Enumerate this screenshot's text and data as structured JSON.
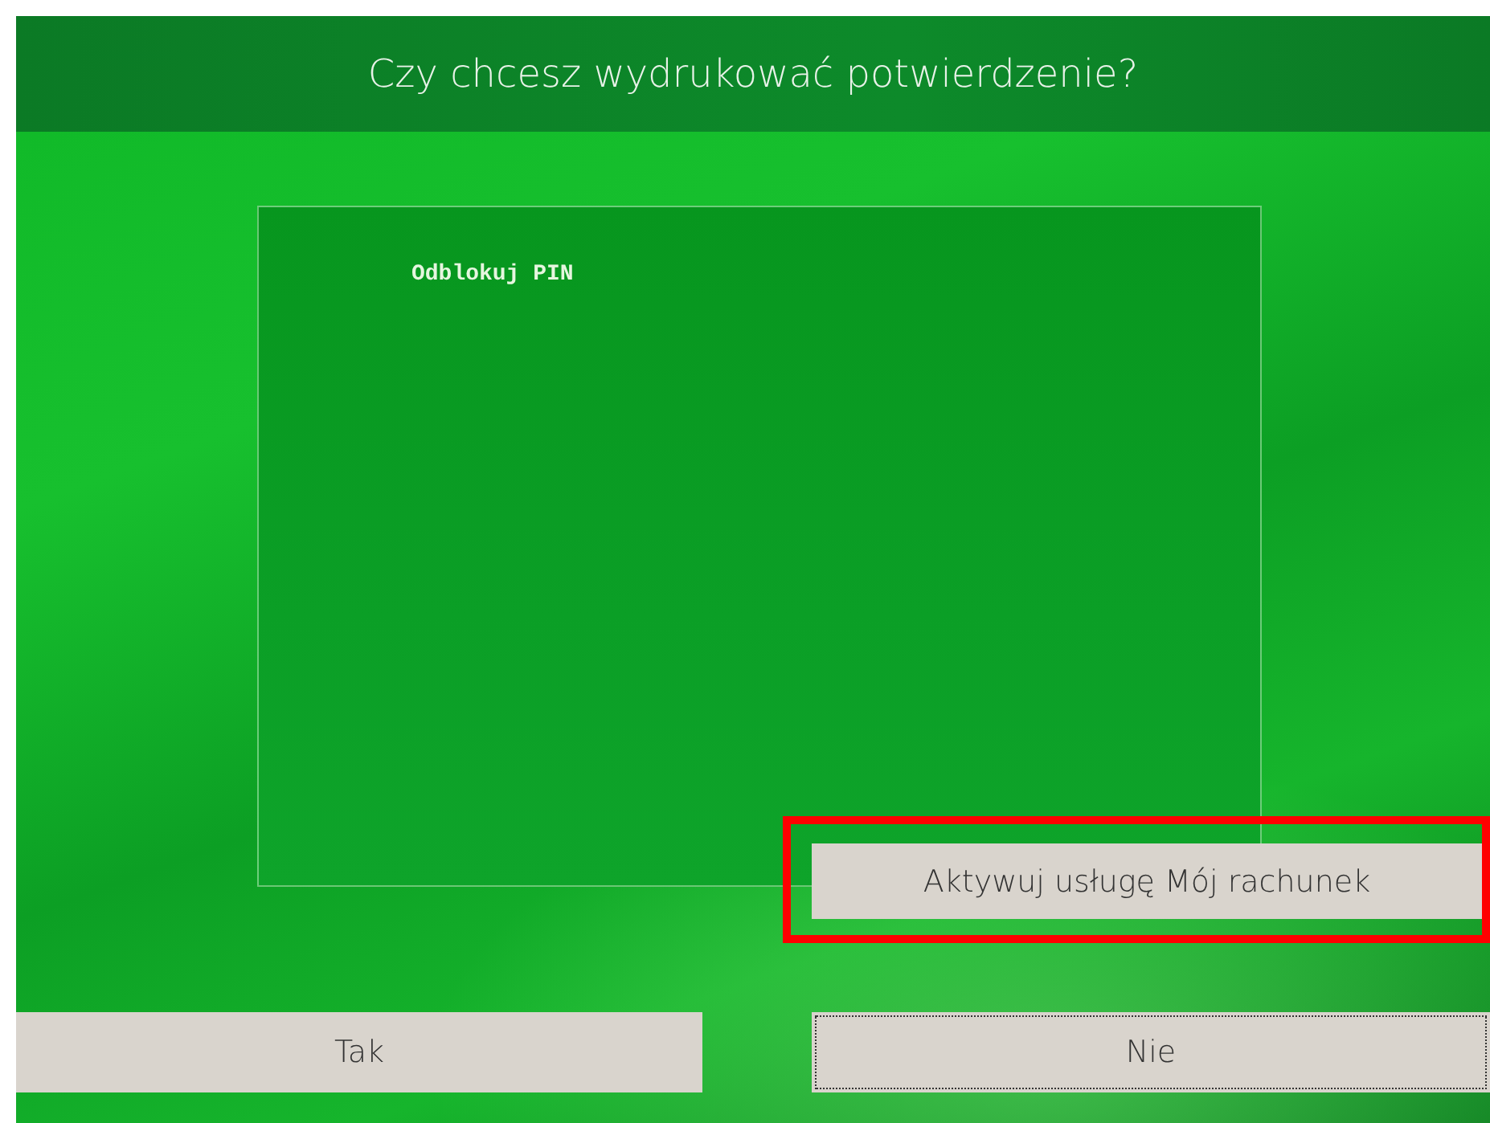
{
  "header": {
    "title": "Czy chcesz wydrukować potwierdzenie?"
  },
  "receipt": {
    "lines": [
      "Odblokuj PIN"
    ]
  },
  "action_button": {
    "label": "Aktywuj usługę Mój rachunek",
    "highlighted": true,
    "focused": false
  },
  "buttons": [
    {
      "label": "Tak",
      "focused": false
    },
    {
      "label": "Nie",
      "focused": true
    }
  ]
}
